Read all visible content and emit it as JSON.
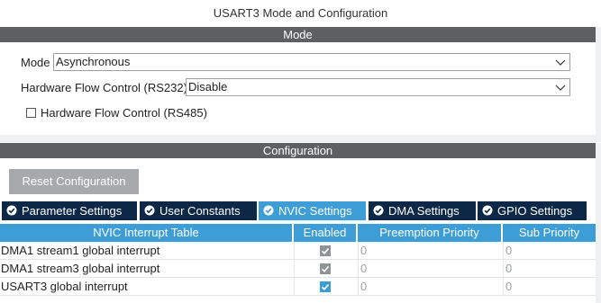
{
  "window": {
    "title": "USART3 Mode and Configuration"
  },
  "mode_section": {
    "header": "Mode",
    "mode": {
      "label": "Mode",
      "value": "Asynchronous"
    },
    "flow_control_rs232": {
      "label": "Hardware Flow Control (RS232)",
      "value": "Disable"
    },
    "flow_control_rs485": {
      "label": "Hardware Flow Control (RS485)",
      "checked": false
    }
  },
  "config_section": {
    "header": "Configuration",
    "reset_button": "Reset Configuration",
    "tabs": [
      {
        "label": "Parameter Settings",
        "active": false
      },
      {
        "label": "User Constants",
        "active": false
      },
      {
        "label": "NVIC Settings",
        "active": true
      },
      {
        "label": "DMA Settings",
        "active": false
      },
      {
        "label": "GPIO Settings",
        "active": false
      }
    ],
    "nvic_table": {
      "columns": [
        "NVIC Interrupt Table",
        "Enabled",
        "Preemption Priority",
        "Sub Priority"
      ],
      "rows": [
        {
          "name": "DMA1 stream1 global interrupt",
          "enabled": true,
          "editable": false,
          "preemption": "0",
          "sub": "0"
        },
        {
          "name": "DMA1 stream3 global interrupt",
          "enabled": true,
          "editable": false,
          "preemption": "0",
          "sub": "0"
        },
        {
          "name": "USART3 global interrupt",
          "enabled": true,
          "editable": true,
          "preemption": "0",
          "sub": "0"
        }
      ]
    }
  },
  "colors": {
    "section_bar": "#5d5f61",
    "tab_inactive": "#0d2847",
    "tab_active": "#3d9dd6",
    "table_header": "#3d9dd6",
    "button": "#a6aaac"
  }
}
